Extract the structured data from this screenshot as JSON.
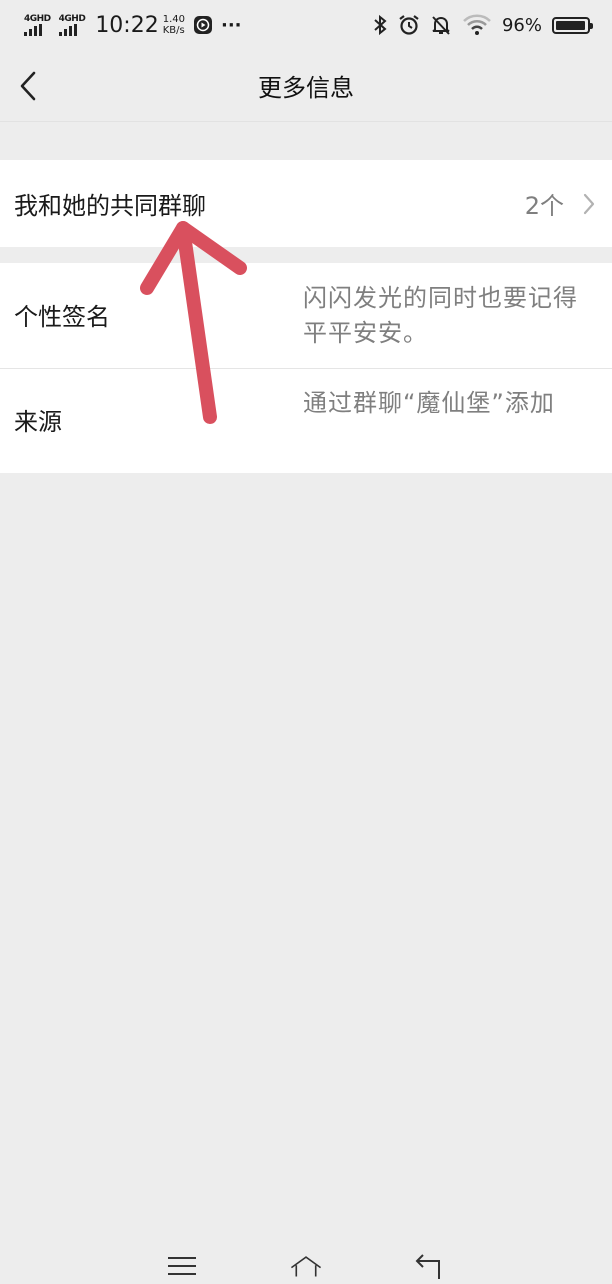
{
  "status_bar": {
    "signal1": "4GHD",
    "signal2": "4GHD",
    "time": "10:22",
    "speed_value": "1.40",
    "speed_unit": "KB/s",
    "more": "···",
    "battery_pct": "96%",
    "battery_level": 0.96
  },
  "nav": {
    "title": "更多信息"
  },
  "common_groups": {
    "label": "我和她的共同群聊",
    "count": "2个"
  },
  "signature": {
    "label": "个性签名",
    "value": "闪闪发光的同时也要记得平平安安。"
  },
  "source": {
    "label": "来源",
    "value": "通过群聊“魔仙堡”添加"
  },
  "colors": {
    "background": "#ededed",
    "card": "#ffffff",
    "annotation_arrow": "#d9505e"
  }
}
